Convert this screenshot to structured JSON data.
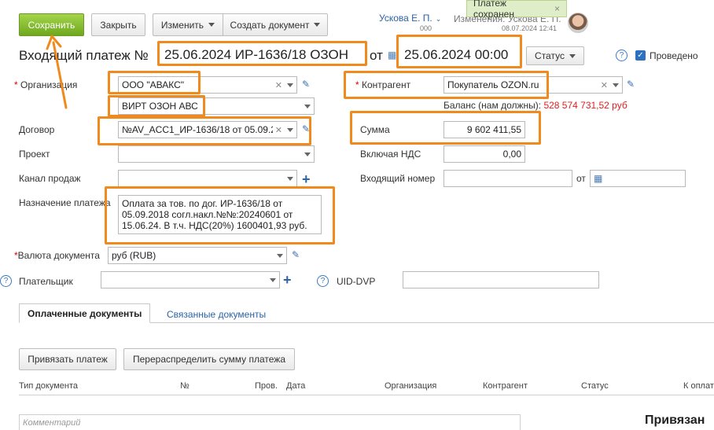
{
  "toolbar": {
    "save_label": "Сохранить",
    "close_label": "Закрыть",
    "edit_label": "Изменить",
    "create_doc_label": "Создать документ"
  },
  "user": {
    "name": "Ускова Е. П.",
    "sub": "000",
    "changed_label": "Изменения: Ускова Е. П.",
    "changed_date": "08.07.2024 12:41"
  },
  "toast": {
    "text": "Платеж сохранен",
    "close": "×"
  },
  "header": {
    "title_prefix": "Входящий платеж №",
    "number": "25.06.2024 ИР-1636/18 ОЗОН",
    "from": "от",
    "datetime": "25.06.2024 00:00",
    "status_label": "Статус",
    "posted_label": "Проведено"
  },
  "form": {
    "org_label": "Организация",
    "org_value": "ООО \"АВАКС\"",
    "org_sub_value": "ВИРТ ОЗОН АВС",
    "counterparty_label": "Контрагент",
    "counterparty_value": "Покупатель OZON.ru",
    "balance_label": "Баланс (нам должны):",
    "balance_value": "528 574 731,52 руб",
    "contract_label": "Договор",
    "contract_value": "№AV_ACC1_ИР-1636/18 от 05.09.2",
    "sum_label": "Сумма",
    "sum_value": "9 602 411,55",
    "project_label": "Проект",
    "vat_label": "Включая НДС",
    "vat_value": "0,00",
    "channel_label": "Канал продаж",
    "incoming_num_label": "Входящий номер",
    "incoming_from": "от",
    "purpose_label": "Назначение платежа",
    "purpose_value": "Оплата за тов. по дог. ИР-1636/18 от 05.09.2018 согл.накл.№№:20240601 от 15.06.24. В т.ч. НДС(20%) 1600401,93 руб.",
    "currency_label": "Валюта документа",
    "currency_value": "руб (RUB)",
    "payer_label": "Плательщик",
    "uid_label": "UID-DVP",
    "help_mark": "?"
  },
  "tabs": [
    {
      "label": "Оплаченные документы"
    },
    {
      "label": "Связанные документы"
    }
  ],
  "actions": {
    "bind_label": "Привязать платеж",
    "redistribute_label": "Перераспределить сумму платежа"
  },
  "table": {
    "columns": [
      "Тип документа",
      "№",
      "Пров.",
      "Дата",
      "Организация",
      "Контрагент",
      "Статус",
      "К оплат"
    ]
  },
  "comment_placeholder": "Комментарий",
  "side_title": "Привязан",
  "colors": {
    "accent_green": "#7cb82f",
    "highlight_orange": "#f08a1c",
    "link_blue": "#2b63a8",
    "balance_red": "#e02020"
  }
}
